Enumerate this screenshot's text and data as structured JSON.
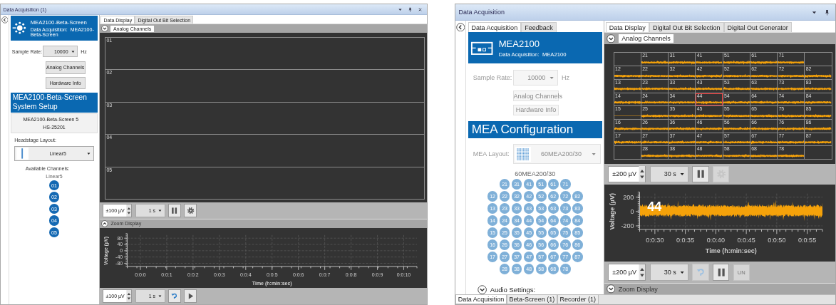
{
  "windows": [
    {
      "title": "Data Acquisition (1)",
      "title_buttons": [
        {
          "kind": "dropdown"
        },
        {
          "kind": "pin"
        },
        {
          "kind": "close"
        }
      ],
      "sidebar": {
        "disabled": false,
        "device": {
          "kind": "dots",
          "name": "MEA2100-Beta-Screen",
          "subtitle": "Data Acquisition:  MEA2100-Beta-Screen"
        },
        "sample_rate": {
          "label": "Sample Rate:",
          "value": "10000",
          "unit": "Hz"
        },
        "buttons": [
          "Analog Channels",
          "Hardware Info"
        ],
        "section_title": "MEA2100-Beta-Screen System Setup",
        "info": [
          "MEA2100-Beta-Screen 5",
          "HS-25201"
        ],
        "layout": {
          "label": "Headstage Layout:",
          "kind": "linear",
          "value": "Linear5"
        },
        "channels_label": "Available Channels:",
        "layout_name": "Linear5",
        "electrodes": [
          [
            "01"
          ],
          [
            "02"
          ],
          [
            "03"
          ],
          [
            "04"
          ],
          [
            "05"
          ]
        ]
      },
      "main": {
        "tabs": [
          {
            "label": "Data Display",
            "selected": true
          },
          {
            "label": "Digital Out Bit Selection",
            "selected": false
          }
        ],
        "panels": [
          {
            "kind": "section",
            "label": "Analog Channels",
            "expanded": false
          },
          {
            "kind": "channels",
            "rows": [
              [
                {
                  "label": "01",
                  "selected": false
                }
              ],
              [
                {
                  "label": "02",
                  "selected": false
                }
              ],
              [
                {
                  "label": "03",
                  "selected": false
                }
              ],
              [
                {
                  "label": "04",
                  "selected": false
                }
              ],
              [
                {
                  "label": "05",
                  "selected": false
                }
              ]
            ]
          },
          {
            "kind": "toolbar",
            "items": [
              {
                "kind": "spinner",
                "value": "±100 µV"
              },
              {
                "kind": "dropdown",
                "value": "1 s"
              },
              {
                "kind": "pause",
                "disabled": false
              },
              {
                "kind": "settings",
                "disabled": false
              }
            ]
          },
          {
            "kind": "caption",
            "label": "Zoom Display",
            "expanded": true
          },
          {
            "kind": "chart",
            "chart_data": {
              "type": "line",
              "grid": true,
              "xlabel": "Time (h:min:sec)",
              "ylabel": "Voltage (µV)",
              "ylim": [
                -100,
                100
              ],
              "categories": [
                "0:0:0",
                "0:0:1",
                "0:0:2",
                "0:0:3",
                "0:0:4",
                "0:0:5",
                "0:0:6",
                "0:0:7",
                "0:0:8",
                "0:0:9",
                "0:0:10"
              ],
              "yticks": [
                80,
                40,
                0,
                -40,
                -80
              ]
            }
          },
          {
            "kind": "toolbar",
            "items": [
              {
                "kind": "spinner",
                "value": "±100 µV"
              },
              {
                "kind": "dropdown",
                "value": "1 s"
              },
              {
                "kind": "undo",
                "disabled": false
              },
              {
                "kind": "play",
                "disabled": false
              }
            ]
          }
        ]
      }
    },
    {
      "title": "Data Acquisition",
      "title_buttons": [
        {
          "kind": "dropdown"
        },
        {
          "kind": "pin"
        }
      ],
      "sidebar": {
        "disabled": true,
        "tabs": [
          {
            "label": "Data Acquisition",
            "selected": true
          },
          {
            "label": "Feedback",
            "selected": false
          }
        ],
        "device": {
          "kind": "box",
          "name": "MEA2100",
          "subtitle": "Data Acquisition:  MEA2100"
        },
        "sample_rate": {
          "label": "Sample Rate:",
          "value": "10000",
          "unit": "Hz"
        },
        "buttons": [
          "Analog Channels",
          "Hardware Info"
        ],
        "section_title": "MEA Configuration",
        "layout": {
          "label": "MEA Layout:",
          "kind": "grid",
          "value": "60MEA200/30"
        },
        "layout_name": "60MEA200/30",
        "electrodes": [
          [
            "21",
            "31",
            "41",
            "51",
            "61",
            "71"
          ],
          [
            "12",
            "22",
            "32",
            "42",
            "52",
            "62",
            "72",
            "82"
          ],
          [
            "13",
            "23",
            "33",
            "43",
            "53",
            "63",
            "73",
            "83"
          ],
          [
            "14",
            "24",
            "34",
            "44",
            "54",
            "64",
            "74",
            "84"
          ],
          [
            "15",
            "25",
            "35",
            "45",
            "55",
            "65",
            "75",
            "85"
          ],
          [
            "16",
            "26",
            "36",
            "46",
            "56",
            "66",
            "76",
            "86"
          ],
          [
            "17",
            "27",
            "37",
            "47",
            "57",
            "67",
            "77",
            "87"
          ],
          [
            "28",
            "38",
            "48",
            "58",
            "68",
            "78"
          ]
        ],
        "audio": {
          "label": "Audio Settings:",
          "expanded": false
        }
      },
      "main": {
        "tabs": [
          {
            "label": "Data Display",
            "selected": true
          },
          {
            "label": "Digital Out Bit Selection",
            "selected": false
          },
          {
            "label": "Digital Out Generator",
            "selected": false
          }
        ],
        "panels": [
          {
            "kind": "section",
            "label": "Analog Channels",
            "expanded": false
          },
          {
            "kind": "channels",
            "rows": [
              [
                {
                  "label": "21",
                  "selected": false,
                  "kind": "noise"
                },
                {
                  "label": "31",
                  "selected": false,
                  "kind": "noise"
                },
                {
                  "label": "41",
                  "selected": false,
                  "kind": "noise"
                },
                {
                  "label": "51",
                  "selected": false,
                  "kind": "noise"
                },
                {
                  "label": "61",
                  "selected": false,
                  "kind": "noise"
                },
                {
                  "label": "71",
                  "selected": false,
                  "kind": "noise"
                }
              ],
              [
                {
                  "label": "12",
                  "selected": false,
                  "kind": "noise"
                },
                {
                  "label": "22",
                  "selected": false,
                  "kind": "noise"
                },
                {
                  "label": "32",
                  "selected": false,
                  "kind": "noise"
                },
                {
                  "label": "42",
                  "selected": false,
                  "kind": "noise"
                },
                {
                  "label": "52",
                  "selected": false,
                  "kind": "noise"
                },
                {
                  "label": "62",
                  "selected": false,
                  "kind": "noise"
                },
                {
                  "label": "72",
                  "selected": false,
                  "kind": "noise"
                },
                {
                  "label": "82",
                  "selected": false,
                  "kind": "noise"
                }
              ],
              [
                {
                  "label": "13",
                  "selected": false,
                  "kind": "noise"
                },
                {
                  "label": "23",
                  "selected": false,
                  "kind": "noise"
                },
                {
                  "label": "33",
                  "selected": false,
                  "kind": "noise"
                },
                {
                  "label": "43",
                  "selected": false,
                  "kind": "noise"
                },
                {
                  "label": "53",
                  "selected": false,
                  "kind": "noise"
                },
                {
                  "label": "63",
                  "selected": false,
                  "kind": "noise"
                },
                {
                  "label": "73",
                  "selected": false,
                  "kind": "noise"
                },
                {
                  "label": "83",
                  "selected": false,
                  "kind": "noise"
                }
              ],
              [
                {
                  "label": "14",
                  "selected": false,
                  "kind": "noise"
                },
                {
                  "label": "24",
                  "selected": false,
                  "kind": "noise"
                },
                {
                  "label": "34",
                  "selected": false,
                  "kind": "noise"
                },
                {
                  "label": "44",
                  "selected": true,
                  "kind": "noise"
                },
                {
                  "label": "54",
                  "selected": false,
                  "kind": "noise"
                },
                {
                  "label": "64",
                  "selected": false,
                  "kind": "noise"
                },
                {
                  "label": "74",
                  "selected": false,
                  "kind": "noise"
                },
                {
                  "label": "84",
                  "selected": false,
                  "kind": "noise"
                }
              ],
              [
                {
                  "label": "15",
                  "selected": false,
                  "kind": "flat"
                },
                {
                  "label": "25",
                  "selected": false,
                  "kind": "noise"
                },
                {
                  "label": "35",
                  "selected": false,
                  "kind": "noise"
                },
                {
                  "label": "45",
                  "selected": false,
                  "kind": "noise"
                },
                {
                  "label": "55",
                  "selected": false,
                  "kind": "noise"
                },
                {
                  "label": "65",
                  "selected": false,
                  "kind": "noise"
                },
                {
                  "label": "75",
                  "selected": false,
                  "kind": "noise"
                },
                {
                  "label": "85",
                  "selected": false,
                  "kind": "noise"
                }
              ],
              [
                {
                  "label": "16",
                  "selected": false,
                  "kind": "noise"
                },
                {
                  "label": "26",
                  "selected": false,
                  "kind": "noise"
                },
                {
                  "label": "36",
                  "selected": false,
                  "kind": "noise"
                },
                {
                  "label": "46",
                  "selected": false,
                  "kind": "noise"
                },
                {
                  "label": "56",
                  "selected": false,
                  "kind": "noise"
                },
                {
                  "label": "66",
                  "selected": false,
                  "kind": "noise"
                },
                {
                  "label": "76",
                  "selected": false,
                  "kind": "noise"
                },
                {
                  "label": "86",
                  "selected": false,
                  "kind": "noise"
                }
              ],
              [
                {
                  "label": "17",
                  "selected": false,
                  "kind": "noise"
                },
                {
                  "label": "27",
                  "selected": false,
                  "kind": "noise"
                },
                {
                  "label": "37",
                  "selected": false,
                  "kind": "noise"
                },
                {
                  "label": "47",
                  "selected": false,
                  "kind": "noise"
                },
                {
                  "label": "57",
                  "selected": false,
                  "kind": "noise"
                },
                {
                  "label": "67",
                  "selected": false,
                  "kind": "noise"
                },
                {
                  "label": "77",
                  "selected": false,
                  "kind": "noise"
                },
                {
                  "label": "87",
                  "selected": false,
                  "kind": "noise"
                }
              ],
              [
                {
                  "label": "28",
                  "selected": false,
                  "kind": "noise"
                },
                {
                  "label": "38",
                  "selected": false,
                  "kind": "noise"
                },
                {
                  "label": "48",
                  "selected": false,
                  "kind": "noise"
                },
                {
                  "label": "58",
                  "selected": false,
                  "kind": "noise"
                },
                {
                  "label": "68",
                  "selected": false,
                  "kind": "noise"
                },
                {
                  "label": "78",
                  "selected": false,
                  "kind": "noise"
                }
              ]
            ]
          },
          {
            "kind": "toolbar",
            "items": [
              {
                "kind": "spinner",
                "value": "±200 µV"
              },
              {
                "kind": "dropdown",
                "value": "30 s"
              },
              {
                "kind": "pause",
                "disabled": false
              },
              {
                "kind": "settings",
                "disabled": true
              }
            ]
          },
          {
            "kind": "chart",
            "label": "44",
            "chart_data": {
              "type": "line",
              "grid": true,
              "xlabel": "Time (h:min:sec)",
              "ylabel": "Voltage (µV)",
              "ylim": [
                -250,
                250
              ],
              "categories": [
                "0:0:30",
                "0:0:35",
                "0:0:40",
                "0:0:45",
                "0:0:50",
                "0:0:55"
              ],
              "yticks": [
                200,
                0,
                -200
              ]
            }
          },
          {
            "kind": "toolbar",
            "items": [
              {
                "kind": "spinner",
                "value": "±200 µV"
              },
              {
                "kind": "dropdown",
                "value": "30 s"
              },
              {
                "kind": "undo",
                "disabled": true
              },
              {
                "kind": "pause",
                "disabled": false
              },
              {
                "kind": "text",
                "label": "UN",
                "disabled": true
              }
            ]
          },
          {
            "kind": "caption",
            "label": "Zoom Display",
            "expanded": false
          }
        ]
      },
      "bottom_tabs": [
        {
          "label": "Data Acquisition",
          "selected": true
        },
        {
          "label": "Beta-Screen (1)",
          "selected": false
        },
        {
          "label": "Recorder (1)",
          "selected": false
        }
      ]
    }
  ]
}
